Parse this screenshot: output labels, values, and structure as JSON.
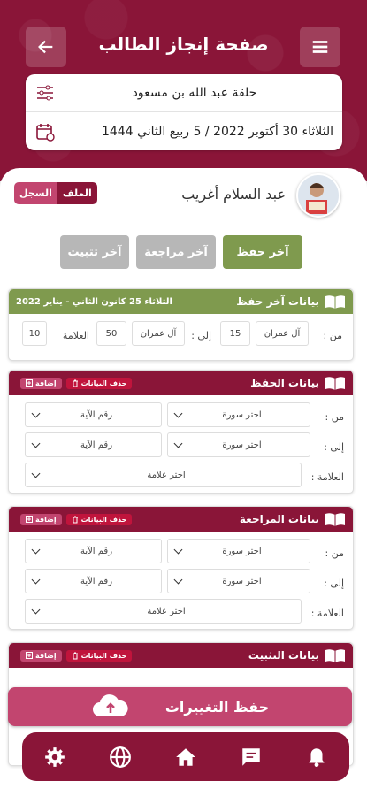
{
  "header": {
    "title": "صفحة إنجاز الطالب",
    "circle": "حلقة عبد الله بن مسعود",
    "date": "الثلاثاء 30 أكتوبر 2022 / 5 ربيع الثاني 1444"
  },
  "student": {
    "name": "عبد السلام أغريب",
    "tab_profile": "الملف",
    "tab_record": "السجل"
  },
  "tabs": {
    "last_memorize": "آخر حفظ",
    "last_review": "آخر مراجعة",
    "last_consolidate": "آخر تثبيت"
  },
  "last_memorize_card": {
    "title": "بيانات آخر حفظ",
    "date": "الثلاثاء 25 كانون الثاني - يناير 2022",
    "from_label": "من :",
    "from_surah": "آل عمران",
    "from_ayah": "15",
    "to_label": "إلى :",
    "to_surah": "آل عمران",
    "to_ayah": "50",
    "grade_label": "العلامة",
    "grade": "10"
  },
  "memorize_card": {
    "title": "بيانات الحفظ",
    "delete": "حذف البيانات",
    "add": "إضافة"
  },
  "review_card": {
    "title": "بيانات المراجعة",
    "delete": "حذف البيانات",
    "add": "إضافة"
  },
  "consolidate_card": {
    "title": "بيانات التثبيت",
    "delete": "حذف البيانات",
    "add": "إضافة"
  },
  "form": {
    "from": "من :",
    "to": "إلى :",
    "grade": "العلامة :",
    "surah_placeholder": "اختر سورة",
    "ayah_placeholder": "رقم الآية",
    "grade_placeholder": "اختر علامة"
  },
  "save_button": "حفظ التغييرات",
  "colors": {
    "primary": "#8a1538",
    "accent_red": "#c0143c",
    "green": "#7f9a4e",
    "gray_tab": "#b7b7b7",
    "save_pink": "#c2456f"
  },
  "icons": [
    "back-arrow-icon",
    "menu-icon",
    "filter-icon",
    "calendar-icon",
    "book-icon",
    "trash-icon",
    "add-icon",
    "cloud-upload-icon",
    "gear-icon",
    "globe-icon",
    "home-icon",
    "chat-icon",
    "bell-icon"
  ]
}
